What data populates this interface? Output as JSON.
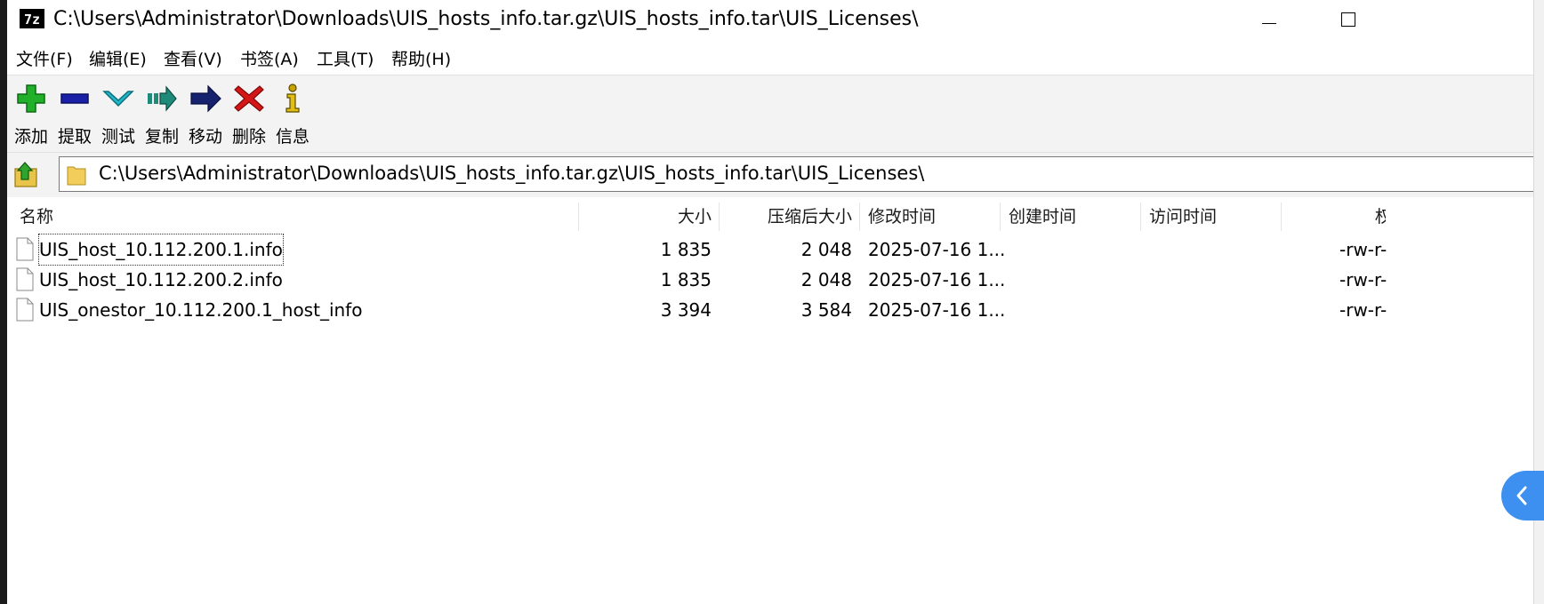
{
  "window": {
    "logo": "7z",
    "title": "C:\\Users\\Administrator\\Downloads\\UIS_hosts_info.tar.gz\\UIS_hosts_info.tar\\UIS_Licenses\\"
  },
  "menu": [
    {
      "label": "文件(F)"
    },
    {
      "label": "编辑(E)"
    },
    {
      "label": "查看(V)"
    },
    {
      "label": "书签(A)"
    },
    {
      "label": "工具(T)"
    },
    {
      "label": "帮助(H)"
    }
  ],
  "toolbar": [
    {
      "label": "添加",
      "icon": "add-icon",
      "color": "#22b02a"
    },
    {
      "label": "提取",
      "icon": "extract-icon",
      "color": "#1a1fa8"
    },
    {
      "label": "测试",
      "icon": "test-icon",
      "color": "#20b6c8"
    },
    {
      "label": "复制",
      "icon": "copy-icon",
      "color": "#1f8a7a"
    },
    {
      "label": "移动",
      "icon": "move-icon",
      "color": "#16226e"
    },
    {
      "label": "删除",
      "icon": "delete-icon",
      "color": "#d41616"
    },
    {
      "label": "信息",
      "icon": "info-icon",
      "color": "#c9a400"
    }
  ],
  "address": {
    "path": "C:\\Users\\Administrator\\Downloads\\UIS_hosts_info.tar.gz\\UIS_hosts_info.tar\\UIS_Licenses\\"
  },
  "columns": {
    "name": "名称",
    "size": "大小",
    "packed": "压缩后大小",
    "modified": "修改时间",
    "created": "创建时间",
    "accessed": "访问时间",
    "attr": "权"
  },
  "files": [
    {
      "name": "UIS_host_10.112.200.1.info",
      "size": "1 835",
      "packed": "2 048",
      "modified": "2025-07-16 1...",
      "created": "",
      "accessed": "",
      "attr": "-rw-r-"
    },
    {
      "name": "UIS_host_10.112.200.2.info",
      "size": "1 835",
      "packed": "2 048",
      "modified": "2025-07-16 1...",
      "created": "",
      "accessed": "",
      "attr": "-rw-r-"
    },
    {
      "name": "UIS_onestor_10.112.200.1_host_info",
      "size": "3 394",
      "packed": "3 584",
      "modified": "2025-07-16 1...",
      "created": "",
      "accessed": "",
      "attr": "-rw-r-"
    }
  ],
  "colors": {
    "toolbar_bg": "#f3f3f3",
    "side_handle": "#3d8ff0"
  }
}
